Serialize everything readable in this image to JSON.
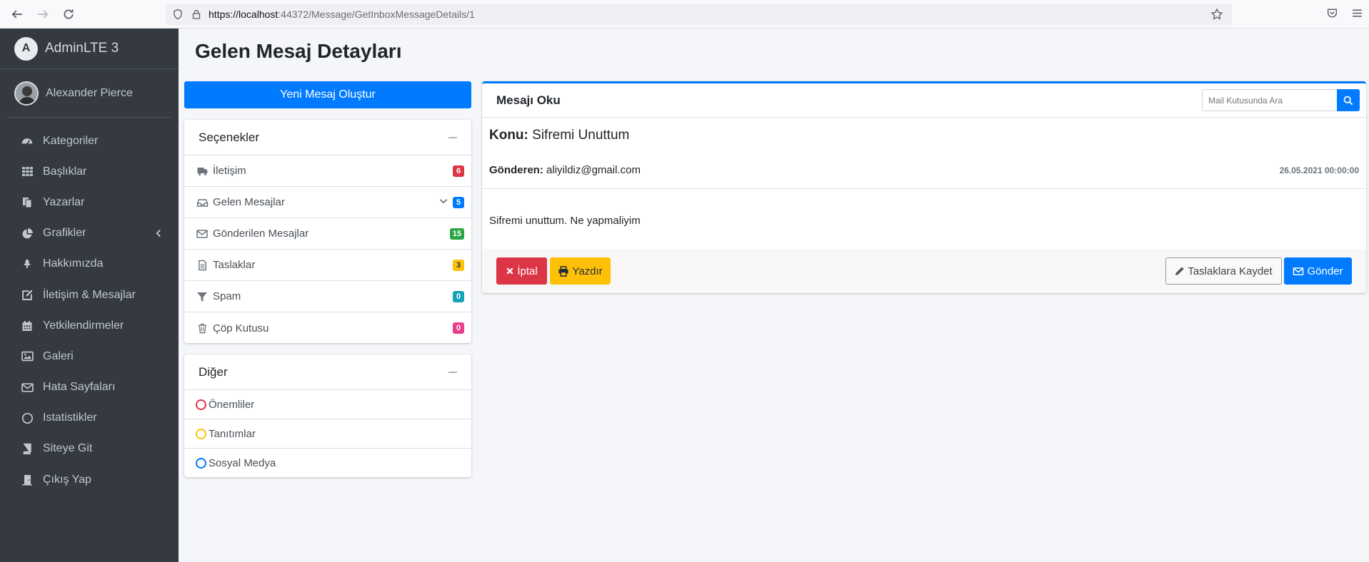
{
  "browser": {
    "url_host": "https://localhost",
    "url_path": ":44372/Message/GetInboxMessageDetails/1"
  },
  "brand": {
    "name": "AdminLTE 3",
    "logo_letter": "A"
  },
  "user": {
    "name": "Alexander Pierce"
  },
  "sidebar": {
    "items": [
      {
        "label": "Kategoriler",
        "icon": "tachometer-icon"
      },
      {
        "label": "Başlıklar",
        "icon": "grid-icon"
      },
      {
        "label": "Yazarlar",
        "icon": "copy-icon"
      },
      {
        "label": "Grafikler",
        "icon": "chart-pie-icon"
      },
      {
        "label": "Hakkımızda",
        "icon": "tree-icon"
      },
      {
        "label": "İletişim & Mesajlar",
        "icon": "edit-icon"
      },
      {
        "label": "Yetkilendirmeler",
        "icon": "calendar-icon"
      },
      {
        "label": "Galeri",
        "icon": "image-icon"
      },
      {
        "label": "Hata Sayfaları",
        "icon": "envelope-icon"
      },
      {
        "label": "Istatistikler",
        "icon": "circle-icon"
      },
      {
        "label": "Siteye Git",
        "icon": "book-icon"
      },
      {
        "label": "Çıkış Yap",
        "icon": "door-icon"
      }
    ]
  },
  "page": {
    "title": "Gelen Mesaj Detayları"
  },
  "compose_button": "Yeni Mesaj Oluştur",
  "folders": {
    "title": "Seçenekler",
    "items": [
      {
        "label": "İletişim",
        "count": "6",
        "color": "#dc3545"
      },
      {
        "label": "Gelen Mesajlar",
        "count": "5",
        "color": "#007bff"
      },
      {
        "label": "Gönderilen Mesajlar",
        "count": "15",
        "color": "#28a745"
      },
      {
        "label": "Taslaklar",
        "count": "3",
        "color": "#ffc107"
      },
      {
        "label": "Spam",
        "count": "0",
        "color": "#17a2b8"
      },
      {
        "label": "Çöp Kutusu",
        "count": "0",
        "color": "#e83e8c"
      }
    ]
  },
  "labels": {
    "title": "Diğer",
    "items": [
      {
        "label": "Önemliler",
        "color": "#dc3545"
      },
      {
        "label": "Tanıtımlar",
        "color": "#ffc107"
      },
      {
        "label": "Sosyal Medya",
        "color": "#007bff"
      }
    ]
  },
  "reader": {
    "title": "Mesajı Oku",
    "search_placeholder": "Mail Kutusunda Ara",
    "subject_label": "Konu:",
    "subject": "Sifremi Unuttum",
    "from_label": "Gönderen:",
    "from": "aliyildiz@gmail.com",
    "date": "26.05.2021 00:00:00",
    "body": "Sifremi unuttum. Ne yapmaliyim",
    "buttons": {
      "cancel": "İptal",
      "print": "Yazdır",
      "save_draft": "Taslaklara Kaydet",
      "send": "Gönder"
    }
  }
}
